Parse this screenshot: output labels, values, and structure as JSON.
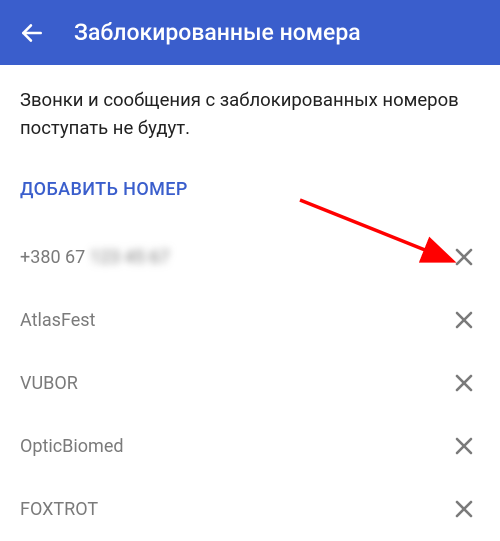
{
  "header": {
    "title": "Заблокированные номера"
  },
  "description": "Звонки и сообщения с заблокированных номеров поступать не будут.",
  "add_label": "ДОБАВИТЬ НОМЕР",
  "numbers": [
    {
      "prefix": "+380 67",
      "rest": "123 45 67"
    },
    {
      "label": "AtlasFest"
    },
    {
      "label": "VUBOR"
    },
    {
      "label": "OpticBiomed"
    },
    {
      "label": "FOXTROT"
    }
  ]
}
